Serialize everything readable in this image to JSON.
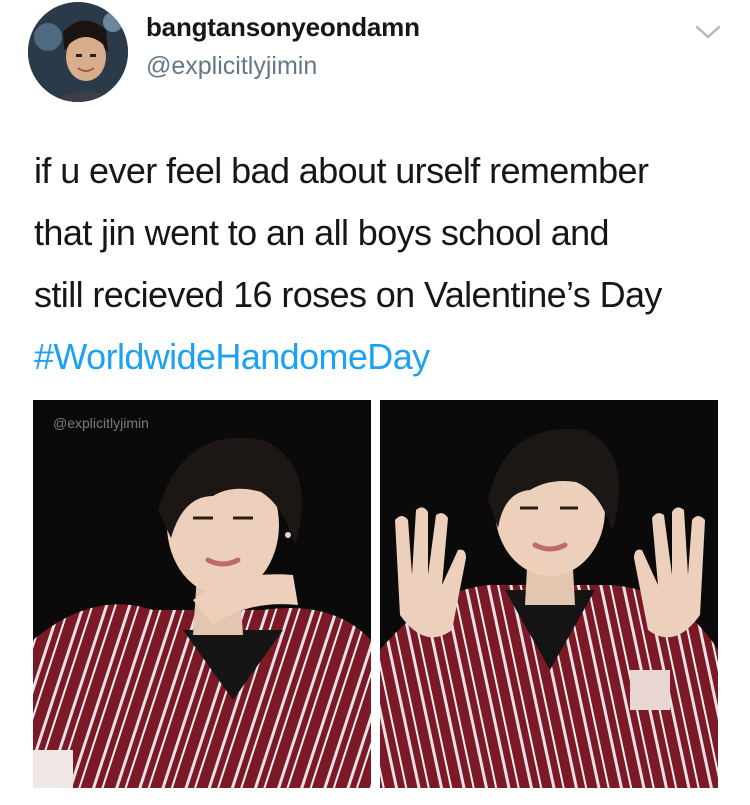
{
  "tweet": {
    "author": {
      "display_name": "bangtansonyeondamn",
      "handle": "@explicitlyjimin",
      "avatar_icon": "profile-photo"
    },
    "menu_icon": "chevron-down-icon",
    "text_lines": [
      "if u ever feel bad about urself remember",
      "that jin went to an all boys school and",
      "still recieved 16 roses on Valentine’s Day"
    ],
    "hashtag": "#WorldwideHandomeDay",
    "media": {
      "watermark": "@explicitlyjimin"
    },
    "colors": {
      "text": "#14171a",
      "secondary": "#657786",
      "link": "#1da1f2",
      "chevron": "#aab8c2"
    }
  }
}
